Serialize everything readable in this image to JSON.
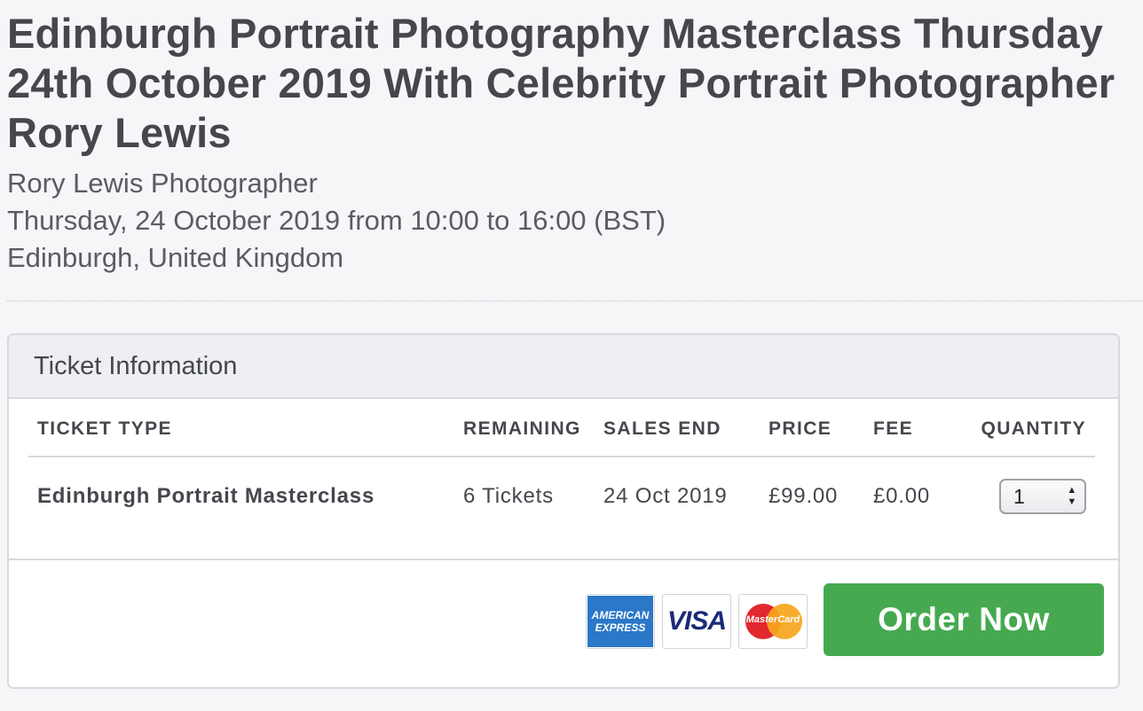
{
  "event": {
    "title": "Edinburgh Portrait Photography Masterclass Thursday 24th October 2019 With Celebrity Portrait Photographer Rory Lewis",
    "organizer": "Rory Lewis Photographer",
    "datetime": "Thursday, 24 October 2019 from 10:00 to 16:00 (BST)",
    "location": "Edinburgh, United Kingdom"
  },
  "tickets": {
    "heading": "Ticket Information",
    "columns": [
      "TICKET TYPE",
      "REMAINING",
      "SALES END",
      "PRICE",
      "FEE",
      "QUANTITY"
    ],
    "rows": [
      {
        "type": "Edinburgh Portrait Masterclass",
        "remaining": "6 Tickets",
        "sales_end": "24 Oct 2019",
        "price": "£99.00",
        "fee": "£0.00",
        "quantity": "1"
      }
    ]
  },
  "payment": {
    "amex_line1": "AMERICAN",
    "amex_line2": "EXPRESS",
    "visa": "VISA",
    "mastercard": "MasterCard",
    "colors": {
      "amex": "#2b77c8",
      "visa": "#1a2a78",
      "mc_red": "#e3272f",
      "mc_yellow": "#f7a51c"
    }
  },
  "order_button": {
    "label": "Order Now",
    "color": "#46a950"
  }
}
